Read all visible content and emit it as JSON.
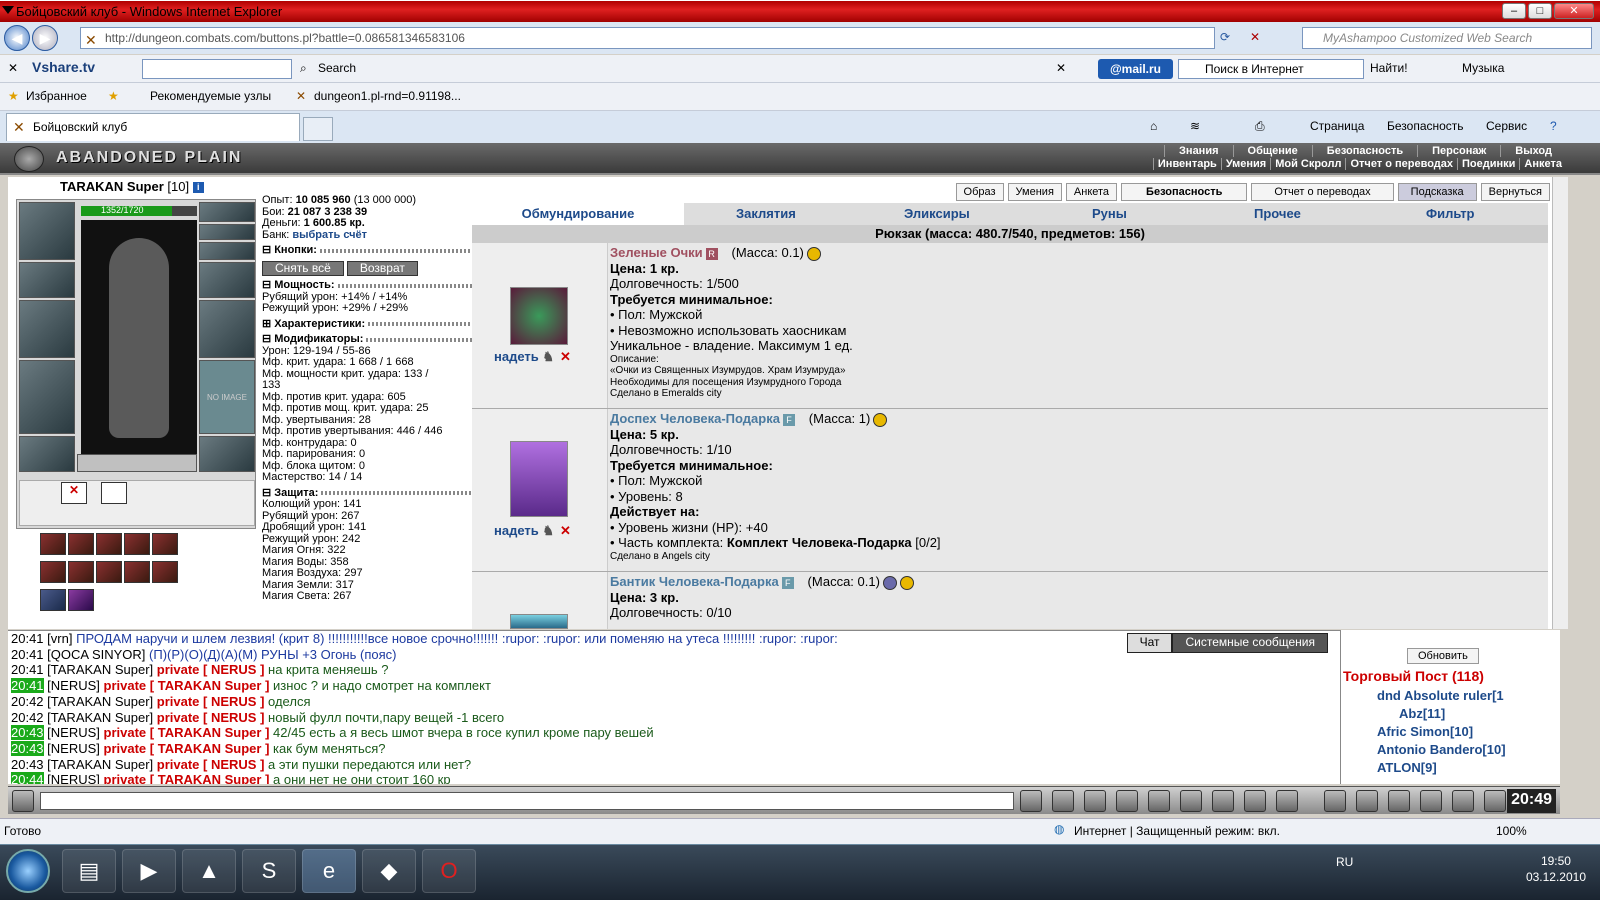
{
  "window": {
    "title": "Бойцовский клуб - Windows Internet Explorer"
  },
  "address": {
    "url": "http://dungeon.combats.com/buttons.pl?battle=0.086581346583106",
    "search_placeholder": "MyAshampoo Customized Web Search"
  },
  "toolbar1": {
    "vshare": "Vshare.tv",
    "search_label": "Search",
    "mailru": "@mail.ru",
    "internet_search": "Поиск в Интернет",
    "find": "Найти!",
    "music": "Музыка"
  },
  "favbar": {
    "favorites": "Избранное",
    "recommended": "Рекомендуемые узлы",
    "link": "dungeon1.pl-rnd=0.91198..."
  },
  "tab": {
    "label": "Бойцовский клуб"
  },
  "cmdbar": {
    "page": "Страница",
    "security": "Безопасность",
    "service": "Сервис"
  },
  "game": {
    "location": "ABANDONED PLAIN",
    "menu_top": [
      "Знания",
      "Общение",
      "Безопасность",
      "Персонаж",
      "Выход"
    ],
    "menu_bottom": [
      "Инвентарь",
      "Умения",
      "Мой Скролл",
      "Отчет о переводах",
      "Поединки",
      "Анкета"
    ],
    "top_buttons": [
      "Образ",
      "Умения",
      "Анкета",
      "Безопасность",
      "Отчет о переводах",
      "Подсказка",
      "Вернуться"
    ],
    "character": {
      "name": "TARAKAN Super",
      "level": "[10]",
      "hp": "1352/1720",
      "no_image": "NO IMAGE"
    },
    "stats": {
      "exp": "Опыт:",
      "exp_val": "10 085 960",
      "exp_next": "(13 000 000)",
      "fights": "Бои:",
      "wins": "21 087",
      "losses": "3 238",
      "draws": "39",
      "money": "Деньги:",
      "money_val": "1 600.85 кр.",
      "bank": "Банк:",
      "bank_link": "выбрать счёт",
      "buttons_hdr": "Кнопки:",
      "undress": "Снять всё",
      "return": "Возврат",
      "power_hdr": "Мощность:",
      "power": [
        "Рубящий урон: +14% / +14%",
        "Режущий урон: +29% / +29%"
      ],
      "chars_hdr": "Характеристики:",
      "mods_hdr": "Модификаторы:",
      "mods": [
        "Урон: 129-194 / 55-86",
        "Мф. крит. удара: 1 668 / 1 668",
        "Мф. мощности крит. удара: 133 /",
        "133",
        "Мф. против крит. удара: 605",
        "Мф. против мощ. крит. удара: 25",
        "Мф. увертывания: 28",
        "Мф. против увертывания: 446 / 446",
        "Мф. контрудара: 0",
        "Мф. парирования: 0",
        "Мф. блока щитом: 0",
        "Мастерство: 14 / 14"
      ],
      "def_hdr": "Защита:",
      "defense": [
        "Колющий урон: 141",
        "Рубящий урон: 267",
        "Дробящий урон: 141",
        "Режущий урон: 242",
        "Магия Огня: 322",
        "Магия Воды: 358",
        "Магия Воздуха: 297",
        "Магия Земли: 317",
        "Магия Света: 267"
      ]
    },
    "inv_tabs": [
      "Обмундирование",
      "Заклятия",
      "Эликсиры",
      "Руны",
      "Прочее",
      "Фильтр"
    ],
    "bag": "Рюкзак (масса: 480.7/540, предметов: 156)",
    "equip_label": "надеть",
    "items": [
      {
        "name": "Зеленые Очки",
        "badge": "R",
        "mass": "(Масса: 0.1)",
        "lines": [
          "Цена: 1 кр.",
          "Долговечность: 1/500"
        ],
        "req_hdr": "Требуется минимальное:",
        "req": [
          "• Пол: Мужской",
          "• Невозможно использовать хаосникам",
          "Уникальное - владение. Максимум 1 ед."
        ],
        "small": [
          "Описание:",
          "«Очки из Священных Изумрудов. Храм Изумруда»",
          "Необходимы для посещения Изумрудного Города",
          "Сделано в Emeralds city"
        ]
      },
      {
        "name": "Доспех Человека-Подарка",
        "badge": "F",
        "mass": "(Масса: 1)",
        "lines": [
          "Цена: 5 кр.",
          "Долговечность: 1/10"
        ],
        "req_hdr": "Требуется минимальное:",
        "req": [
          "• Пол: Мужской",
          "• Уровень: 8"
        ],
        "act_hdr": "Действует на:",
        "act": [
          "• Уровень жизни (HP): +40",
          "• Часть комплекта: "
        ],
        "set_name": "Комплект Человека-Подарка",
        "set_count": " [0/2]",
        "small": [
          "Сделано в Angels city"
        ]
      },
      {
        "name": "Бантик Человека-Подарка",
        "badge": "F",
        "mass": "(Масса: 0.1)",
        "lines": [
          "Цена: 3 кр.",
          "Долговечность: 0/10"
        ]
      }
    ]
  },
  "chat": {
    "tabs": [
      "Чат",
      "Системные сообщения"
    ],
    "lines": [
      {
        "t": "20:41",
        "hl": false,
        "nick": "[vrn]",
        "priv": "",
        "msg": "ПРОДАМ наручи и шлем лезвия! (крит 8) !!!!!!!!!!!все новое срочно!!!!!!! :rupor: :rupor: или поменяю на утеса !!!!!!!!! :rupor: :rupor:",
        "blue": true
      },
      {
        "t": "20:41",
        "hl": false,
        "nick": "[QOCA SINYOR]",
        "priv": "",
        "msg": "(П)(Р)(О)(Д)(А)(М) РУНЫ +3 Огонь (пояс)",
        "blue": true
      },
      {
        "t": "20:41",
        "hl": false,
        "nick": "[TARAKAN Super]",
        "priv": "private [ NERUS ]",
        "msg": "на крита меняешь ?",
        "blue": false
      },
      {
        "t": "20:41",
        "hl": true,
        "nick": "[NERUS]",
        "priv": "private [ TARAKAN Super ]",
        "msg": "износ ? и надо смотрет на комплект",
        "blue": false
      },
      {
        "t": "20:42",
        "hl": false,
        "nick": "[TARAKAN Super]",
        "priv": "private [ NERUS ]",
        "msg": "оделся",
        "blue": false
      },
      {
        "t": "20:42",
        "hl": false,
        "nick": "[TARAKAN Super]",
        "priv": "private [ NERUS ]",
        "msg": "новый фулл почти,пару вещей -1 всего",
        "blue": false
      },
      {
        "t": "20:43",
        "hl": true,
        "nick": "[NERUS]",
        "priv": "private [ TARAKAN Super ]",
        "msg": "42/45 есть а я весь шмот вчера в госе купил кроме пару вешей",
        "blue": false
      },
      {
        "t": "20:43",
        "hl": true,
        "nick": "[NERUS]",
        "priv": "private [ TARAKAN Super ]",
        "msg": "как бум меняться?",
        "blue": false
      },
      {
        "t": "20:43",
        "hl": false,
        "nick": "[TARAKAN Super]",
        "priv": "private [ NERUS ]",
        "msg": "а эти пушки передаются или нет?",
        "blue": false
      },
      {
        "t": "20:44",
        "hl": true,
        "nick": "[NERUS]",
        "priv": "private [ TARAKAN Super ]",
        "msg": "а они нет не они стоит 160 кр",
        "blue": false
      }
    ]
  },
  "rpanel": {
    "refresh": "Обновить",
    "title": "Торговый Пост (118)",
    "players": [
      "dnd Absolute ruler[1",
      "Abz[11]",
      "Afric Simon[10]",
      "Antonio Bandero[10]",
      "ATLON[9]"
    ]
  },
  "gamebar": {
    "clock": "20:49"
  },
  "statusbar": {
    "ready": "Готово",
    "zone": "Интернет | Защищенный режим: вкл.",
    "zoom": "100%"
  },
  "taskbar": {
    "lang": "RU",
    "time": "19:50",
    "date": "03.12.2010"
  }
}
